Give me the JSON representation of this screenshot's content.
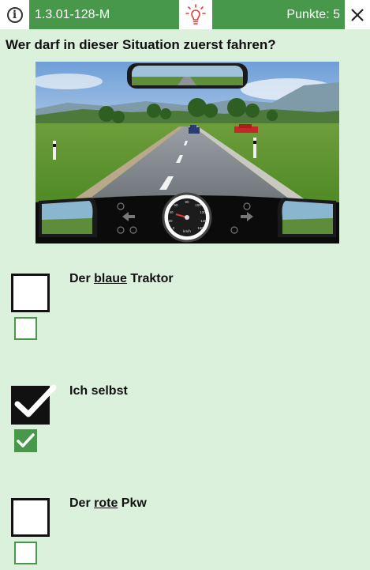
{
  "header": {
    "question_id": "1.3.01-128-M",
    "score": "Punkte: 5",
    "info_icon": "info-icon",
    "hint_icon": "lightbulb-icon",
    "close_icon": "close-icon",
    "accent_color": "#47984a"
  },
  "question": {
    "text": "Wer darf in dieser Situation zuerst fahren?"
  },
  "dashboard": {
    "speed_unit": "km/h",
    "speed_ticks": [
      "0",
      "20",
      "40",
      "60",
      "80",
      "100",
      "120",
      "140",
      "160"
    ]
  },
  "answers": [
    {
      "before": "Der ",
      "underlined": "blaue",
      "after": " Traktor",
      "big_checked": false,
      "small_checked": false
    },
    {
      "before": "Ich selbst",
      "underlined": "",
      "after": "",
      "big_checked": true,
      "small_checked": true
    },
    {
      "before": "Der ",
      "underlined": "rote",
      "after": " Pkw",
      "big_checked": false,
      "small_checked": false
    }
  ]
}
